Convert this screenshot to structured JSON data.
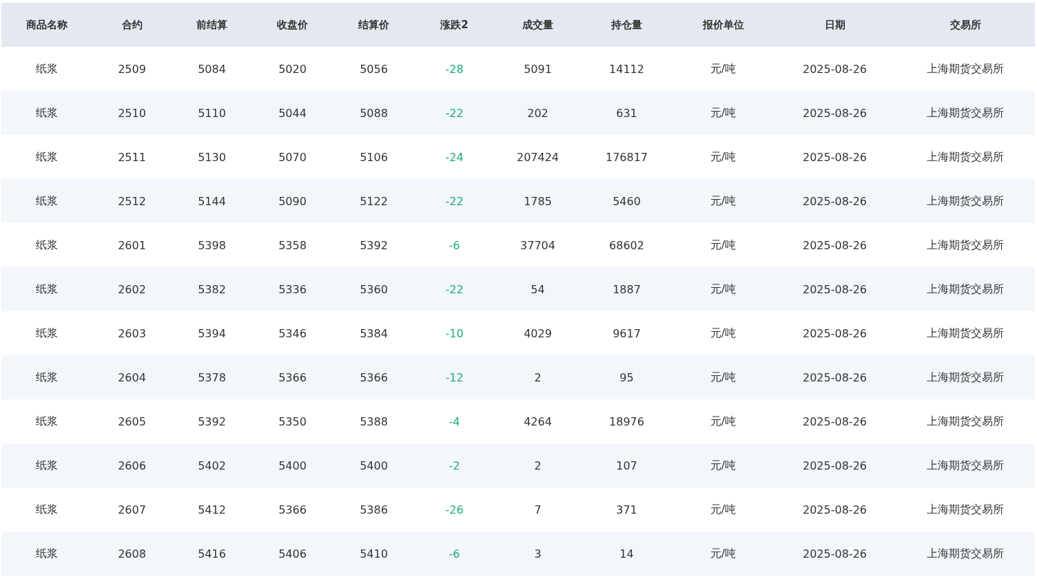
{
  "table": {
    "columns": [
      "商品名称",
      "合约",
      "前结算",
      "收盘价",
      "结算价",
      "涨跌2",
      "成交量",
      "持仓量",
      "报价单位",
      "日期",
      "交易所"
    ],
    "rows": [
      {
        "cells": [
          "纸浆",
          "2509",
          "5084",
          "5020",
          "5056",
          "-28",
          "5091",
          "14112",
          "元/吨",
          "2025-08-26",
          "上海期货交易所"
        ],
        "falling": true
      },
      {
        "cells": [
          "纸浆",
          "2510",
          "5110",
          "5044",
          "5088",
          "-22",
          "202",
          "631",
          "元/吨",
          "2025-08-26",
          "上海期货交易所"
        ],
        "falling": true
      },
      {
        "cells": [
          "纸浆",
          "2511",
          "5130",
          "5070",
          "5106",
          "-24",
          "207424",
          "176817",
          "元/吨",
          "2025-08-26",
          "上海期货交易所"
        ],
        "falling": true
      },
      {
        "cells": [
          "纸浆",
          "2512",
          "5144",
          "5090",
          "5122",
          "-22",
          "1785",
          "5460",
          "元/吨",
          "2025-08-26",
          "上海期货交易所"
        ],
        "falling": true
      },
      {
        "cells": [
          "纸浆",
          "2601",
          "5398",
          "5358",
          "5392",
          "-6",
          "37704",
          "68602",
          "元/吨",
          "2025-08-26",
          "上海期货交易所"
        ],
        "falling": true
      },
      {
        "cells": [
          "纸浆",
          "2602",
          "5382",
          "5336",
          "5360",
          "-22",
          "54",
          "1887",
          "元/吨",
          "2025-08-26",
          "上海期货交易所"
        ],
        "falling": true
      },
      {
        "cells": [
          "纸浆",
          "2603",
          "5394",
          "5346",
          "5384",
          "-10",
          "4029",
          "9617",
          "元/吨",
          "2025-08-26",
          "上海期货交易所"
        ],
        "falling": true
      },
      {
        "cells": [
          "纸浆",
          "2604",
          "5378",
          "5366",
          "5366",
          "-12",
          "2",
          "95",
          "元/吨",
          "2025-08-26",
          "上海期货交易所"
        ],
        "falling": true
      },
      {
        "cells": [
          "纸浆",
          "2605",
          "5392",
          "5350",
          "5388",
          "-4",
          "4264",
          "18976",
          "元/吨",
          "2025-08-26",
          "上海期货交易所"
        ],
        "falling": true
      },
      {
        "cells": [
          "纸浆",
          "2606",
          "5402",
          "5400",
          "5400",
          "-2",
          "2",
          "107",
          "元/吨",
          "2025-08-26",
          "上海期货交易所"
        ],
        "falling": true
      },
      {
        "cells": [
          "纸浆",
          "2607",
          "5412",
          "5366",
          "5386",
          "-26",
          "7",
          "371",
          "元/吨",
          "2025-08-26",
          "上海期货交易所"
        ],
        "falling": true
      },
      {
        "cells": [
          "纸浆",
          "2608",
          "5416",
          "5406",
          "5410",
          "-6",
          "3",
          "14",
          "元/吨",
          "2025-08-26",
          "上海期货交易所"
        ],
        "falling": true
      }
    ]
  }
}
